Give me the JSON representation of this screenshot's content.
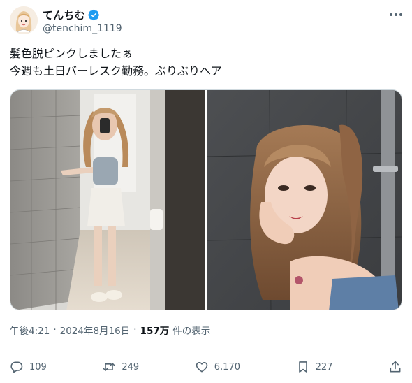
{
  "author": {
    "display_name": "てんちむ",
    "handle": "@tenchim_1119",
    "verified": true,
    "avatar_icon": "user-avatar"
  },
  "tweet": {
    "lines": [
      "髪色脱ピンクしましたぁ",
      "今週も土日バーレスク勤務。ぶりぶりヘア"
    ]
  },
  "media": {
    "count": 2
  },
  "meta": {
    "time": "午後4:21",
    "separator": "·",
    "date": "2024年8月16日",
    "views_count": "157万",
    "views_label": "件の表示"
  },
  "actions": {
    "replies": "109",
    "reposts": "249",
    "likes": "6,170",
    "bookmarks": "227"
  },
  "colors": {
    "text": "#0f1419",
    "secondary": "#536471",
    "verified": "#1d9bf0",
    "border": "#cfd9de"
  }
}
